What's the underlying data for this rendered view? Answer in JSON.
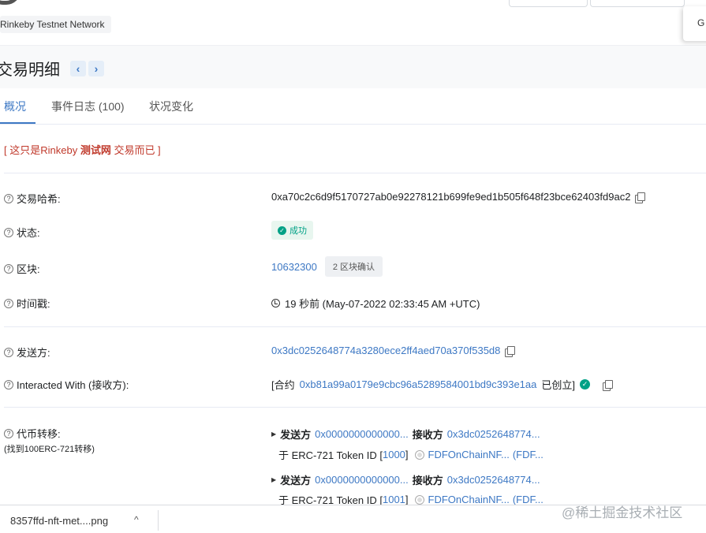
{
  "header": {
    "network_label": "Rinkeby Testnet Network",
    "side_tab_label": "G"
  },
  "titlebar": {
    "title": "交易明细",
    "prev_icon": "chevron-left-icon",
    "next_icon": "chevron-right-icon"
  },
  "tabs": [
    {
      "label": "概况",
      "active": true
    },
    {
      "label": "事件日志 (100)",
      "active": false
    },
    {
      "label": "状况变化",
      "active": false
    }
  ],
  "notice": {
    "prefix": "[ 这只是Rinkeby ",
    "bold": "测试网",
    "suffix": " 交易而已 ]"
  },
  "rows": {
    "tx_hash": {
      "label": "交易哈希:",
      "value": "0xa70c2c6d9f5170727ab0e92278121b699fe9ed1b505f648f23bce62403fd9ac2"
    },
    "status": {
      "label": "状态:",
      "value": "成功"
    },
    "block": {
      "label": "区块:",
      "value": "10632300",
      "confirmations": "2 区块确认"
    },
    "timestamp": {
      "label": "时间戳:",
      "value": "19 秒前 (May-07-2022 02:33:45 AM +UTC)"
    },
    "from": {
      "label": "发送方:",
      "value": "0x3dc0252648774a3280ece2ff4aed70a370f535d8"
    },
    "interacted": {
      "label": "Interacted With (接收方):",
      "prefix": "[合约",
      "address": "0xb81a99a0179e9cbc96a5289584001bd9c393e1aa",
      "suffix": "已创立]"
    },
    "transfers": {
      "label": "代币转移:",
      "sub_label": "(找到100ERC-721转移)",
      "items": [
        {
          "from_label": "发送方",
          "from": "0x0000000000000...",
          "to_label": "接收方",
          "to": "0x3dc0252648774...",
          "for_label": "于 ERC-721 Token ID [",
          "token_id": "1000",
          "close_bracket": "]",
          "token_name": "FDFOnChainNF...",
          "token_symbol": "(FDF..."
        },
        {
          "from_label": "发送方",
          "from": "0x0000000000000...",
          "to_label": "接收方",
          "to": "0x3dc0252648774...",
          "for_label": "于 ERC-721 Token ID [",
          "token_id": "1001",
          "close_bracket": "]",
          "token_name": "FDFOnChainNF...",
          "token_symbol": "(FDF..."
        }
      ]
    }
  },
  "download_bar": {
    "filename": "8357ffd-nft-met....png",
    "chevron": "^"
  },
  "watermark": "@稀土掘金技术社区",
  "colors": {
    "link": "#3d78c4",
    "success": "#00a186",
    "notice": "#c0392b"
  }
}
